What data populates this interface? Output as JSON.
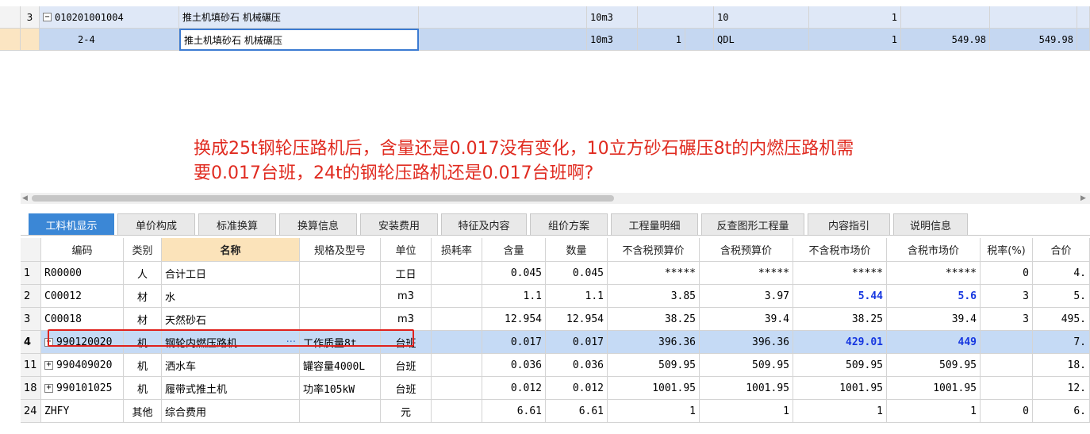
{
  "top_grid": {
    "row1": {
      "num": "3",
      "code": "010201001004",
      "name": "推土机填砂石 机械碾压",
      "unit": "10m3",
      "qty": "",
      "qdl": "10",
      "coef": "1",
      "price": "",
      "total": ""
    },
    "row2": {
      "num": "",
      "code": "2-4",
      "name": "推土机填砂石 机械碾压",
      "unit": "10m3",
      "qty": "1",
      "qdl": "QDL",
      "coef": "1",
      "price": "549.98",
      "total": "549.98"
    }
  },
  "annotation": {
    "line1": "换成25t钢轮压路机后，含量还是0.017没有变化，10立方砂石碾压8t的内燃压路机需",
    "line2": "要0.017台班，24t的钢轮压路机还是0.017台班啊?"
  },
  "tabs": [
    "工料机显示",
    "单价构成",
    "标准换算",
    "换算信息",
    "安装费用",
    "特征及内容",
    "组价方案",
    "工程量明细",
    "反查图形工程量",
    "内容指引",
    "说明信息"
  ],
  "table": {
    "headers": [
      "编码",
      "类别",
      "名称",
      "规格及型号",
      "单位",
      "损耗率",
      "含量",
      "数量",
      "不含税预算价",
      "含税预算价",
      "不含税市场价",
      "含税市场价",
      "税率(%)",
      "合价"
    ],
    "rows": [
      {
        "rn": "1",
        "code": "R00000",
        "type": "人",
        "name": "合计工日",
        "spec": "",
        "unit": "工日",
        "loss": "",
        "content": "0.045",
        "qty": "0.045",
        "p1": "*****",
        "p2": "*****",
        "p3": "*****",
        "p4": "*****",
        "tax": "0",
        "total": "4."
      },
      {
        "rn": "2",
        "code": "C00012",
        "type": "材",
        "name": "水",
        "spec": "",
        "unit": "m3",
        "loss": "",
        "content": "1.1",
        "qty": "1.1",
        "p1": "3.85",
        "p2": "3.97",
        "p3": "5.44",
        "p4": "5.6",
        "tax": "3",
        "total": "5."
      },
      {
        "rn": "3",
        "code": "C00018",
        "type": "材",
        "name": "天然砂石",
        "spec": "",
        "unit": "m3",
        "loss": "",
        "content": "12.954",
        "qty": "12.954",
        "p1": "38.25",
        "p2": "39.4",
        "p3": "38.25",
        "p4": "39.4",
        "tax": "3",
        "total": "495."
      },
      {
        "rn": "4",
        "code": "990120020",
        "type": "机",
        "name": "钢轮内燃压路机",
        "spec": "工作质量8t",
        "unit": "台班",
        "loss": "",
        "content": "0.017",
        "qty": "0.017",
        "p1": "396.36",
        "p2": "396.36",
        "p3": "429.01",
        "p4": "449",
        "tax": "",
        "total": "7."
      },
      {
        "rn": "11",
        "code": "990409020",
        "type": "机",
        "name": "洒水车",
        "spec": "罐容量4000L",
        "unit": "台班",
        "loss": "",
        "content": "0.036",
        "qty": "0.036",
        "p1": "509.95",
        "p2": "509.95",
        "p3": "509.95",
        "p4": "509.95",
        "tax": "",
        "total": "18."
      },
      {
        "rn": "18",
        "code": "990101025",
        "type": "机",
        "name": "履带式推土机",
        "spec": "功率105kW",
        "unit": "台班",
        "loss": "",
        "content": "0.012",
        "qty": "0.012",
        "p1": "1001.95",
        "p2": "1001.95",
        "p3": "1001.95",
        "p4": "1001.95",
        "tax": "",
        "total": "12."
      },
      {
        "rn": "24",
        "code": "ZHFY",
        "type": "其他",
        "name": "综合费用",
        "spec": "",
        "unit": "元",
        "loss": "",
        "content": "6.61",
        "qty": "6.61",
        "p1": "1",
        "p2": "1",
        "p3": "1",
        "p4": "1",
        "tax": "0",
        "total": "6."
      }
    ]
  },
  "icons": {
    "expand": "+",
    "collapse": "−",
    "more": "···"
  }
}
